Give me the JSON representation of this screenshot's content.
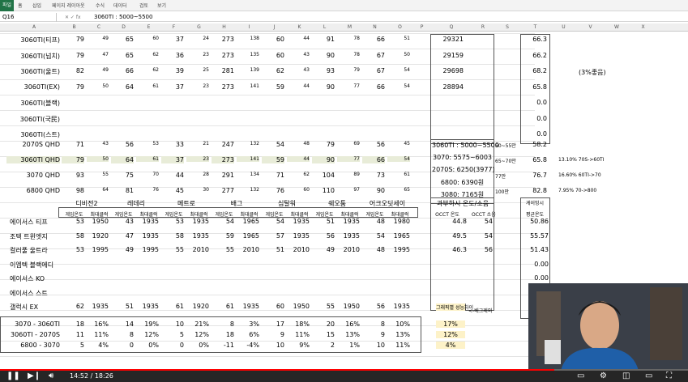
{
  "ribbon": {
    "file": "파일",
    "tabs": [
      "홈",
      "삽입",
      "페이지 레이아웃",
      "수식",
      "데이터",
      "검토",
      "보기"
    ]
  },
  "formula": {
    "namebox": "Q16",
    "value": "3060TI : 5000~5500"
  },
  "columns": [
    "A",
    "B",
    "C",
    "D",
    "E",
    "F",
    "G",
    "H",
    "I",
    "J",
    "K",
    "L",
    "M",
    "N",
    "O",
    "P",
    "Q",
    "R",
    "S",
    "T",
    "U",
    "V",
    "W",
    "X"
  ],
  "block1": [
    {
      "name": "3060TI(티프)",
      "v": [
        "79",
        "49",
        "65",
        "60",
        "37",
        "24",
        "273",
        "138",
        "60",
        "44",
        "91",
        "78",
        "66",
        "51"
      ],
      "q": "29321",
      "t": "66.3"
    },
    {
      "name": "3060TI(넙치)",
      "v": [
        "79",
        "47",
        "65",
        "62",
        "36",
        "23",
        "273",
        "135",
        "60",
        "43",
        "90",
        "78",
        "67",
        "50"
      ],
      "q": "29159",
      "t": "66.2"
    },
    {
      "name": "3060TI(울트)",
      "v": [
        "82",
        "49",
        "66",
        "62",
        "39",
        "25",
        "281",
        "139",
        "62",
        "43",
        "93",
        "79",
        "67",
        "54"
      ],
      "q": "29698",
      "t": "68.2"
    },
    {
      "name": "3060TI(EX)",
      "v": [
        "79",
        "50",
        "64",
        "61",
        "37",
        "23",
        "273",
        "141",
        "59",
        "44",
        "90",
        "77",
        "66",
        "54"
      ],
      "q": "28894",
      "t": "65.8"
    },
    {
      "name": "3060TI(블랙)",
      "v": [],
      "q": "",
      "t": "0.0"
    },
    {
      "name": "3060TI(국民)",
      "v": [],
      "q": "",
      "t": "0.0"
    },
    {
      "name": "3060TI(스트)",
      "v": [],
      "q": "",
      "t": "0.0"
    }
  ],
  "u3": "(3%좋음)",
  "block2": [
    {
      "name": "2070S QHD",
      "v": [
        "71",
        "43",
        "56",
        "53",
        "33",
        "21",
        "247",
        "132",
        "54",
        "48",
        "79",
        "69",
        "56",
        "45"
      ],
      "t": "58.2",
      "s": "50~55만"
    },
    {
      "name": "3060TI QHD",
      "v": [
        "79",
        "50",
        "64",
        "61",
        "37",
        "23",
        "273",
        "141",
        "59",
        "44",
        "90",
        "77",
        "66",
        "54"
      ],
      "t": "65.8",
      "s": "65~70만",
      "uv": "13.10% 70S->60TI"
    },
    {
      "name": "3070 QHD",
      "v": [
        "93",
        "55",
        "75",
        "70",
        "44",
        "28",
        "291",
        "134",
        "71",
        "62",
        "104",
        "89",
        "73",
        "61"
      ],
      "t": "76.7",
      "s": "77만",
      "uv": "16.60% 60TI->70"
    },
    {
      "name": "6800 QHD",
      "v": [
        "98",
        "64",
        "81",
        "76",
        "45",
        "30",
        "277",
        "132",
        "76",
        "60",
        "110",
        "97",
        "90",
        "65"
      ],
      "t": "82.8",
      "s": "100만",
      "uv": "7.95% 70->800"
    }
  ],
  "pricebox": [
    "3060TI : 5000~5500",
    "3070: 5575~6003",
    "2070S: 6250(3977)",
    "6800: 6390원",
    "3080: 7165원"
  ],
  "games": [
    "디비전2",
    "레데리",
    "메트로",
    "배그",
    "심탈워",
    "쉐오툼",
    "어크오딧세이"
  ],
  "occt": {
    "title": "과부하시 온도/소음",
    "sub": [
      "OCCT 온도",
      "OCCT 소음"
    ]
  },
  "avg": {
    "title": "게이밍시",
    "sub": "평균온도"
  },
  "subhdr": [
    "게임온도",
    "최대클럭"
  ],
  "block3": [
    {
      "name": "에이서스 티프",
      "v": [
        "53",
        "1950",
        "43",
        "1935",
        "53",
        "1935",
        "54",
        "1965",
        "54",
        "1935",
        "51",
        "1935",
        "48",
        "1980"
      ],
      "q": "44.8",
      "r": "54",
      "t": "50.86"
    },
    {
      "name": "조텍 트윈엣지",
      "v": [
        "58",
        "1920",
        "47",
        "1935",
        "58",
        "1935",
        "59",
        "1965",
        "57",
        "1935",
        "56",
        "1935",
        "54",
        "1965"
      ],
      "q": "49.5",
      "r": "54",
      "t": "55.57"
    },
    {
      "name": "컬러풀 울트라",
      "v": [
        "53",
        "1995",
        "49",
        "1995",
        "55",
        "2010",
        "55",
        "2010",
        "51",
        "2010",
        "49",
        "2010",
        "48",
        "1995"
      ],
      "q": "46.3",
      "r": "56",
      "t": "51.43"
    },
    {
      "name": "이엠텍 블랙에디",
      "v": [],
      "q": "",
      "r": "",
      "t": "0.00"
    },
    {
      "name": "에이서스 KO",
      "v": [],
      "q": "",
      "r": "",
      "t": "0.00"
    },
    {
      "name": "에이서스 스트",
      "v": [],
      "q": "",
      "r": "",
      "t": "0.00"
    },
    {
      "name": "갤럭시 EX",
      "v": [
        "62",
        "1935",
        "51",
        "1935",
        "61",
        "1920",
        "61",
        "1935",
        "60",
        "1950",
        "55",
        "1950",
        "56",
        "1935"
      ],
      "q": "불량의심",
      "r": "",
      "t": ""
    }
  ],
  "perfhdr": {
    "q": "그래픽별 성능차이",
    "r": "<-베그제외"
  },
  "block4": [
    {
      "name": "3070 - 3060TI",
      "v": [
        "18",
        "16%",
        "14",
        "19%",
        "10",
        "21%",
        "8",
        "3%",
        "17",
        "18%",
        "20",
        "16%",
        "8",
        "10%"
      ],
      "q": "17%"
    },
    {
      "name": "3060TI - 2070S",
      "v": [
        "11",
        "11%",
        "8",
        "12%",
        "5",
        "12%",
        "18",
        "6%",
        "9",
        "11%",
        "15",
        "13%",
        "9",
        "13%"
      ],
      "q": "12%"
    },
    {
      "name": "6800 - 3070",
      "v": [
        "5",
        "4%",
        "0",
        "0%",
        "0",
        "0%",
        "-11",
        "-4%",
        "10",
        "9%",
        "2",
        "1%",
        "10",
        "11%"
      ],
      "q": "4%"
    }
  ],
  "player": {
    "time": "14:52 / 18:26",
    "progress": 0.806
  }
}
